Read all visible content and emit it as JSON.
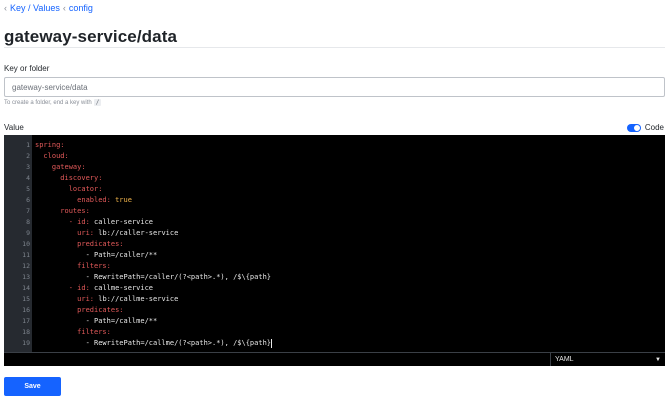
{
  "breadcrumb": {
    "items": [
      "Key / Values",
      "config"
    ]
  },
  "page": {
    "title": "gateway-service/data"
  },
  "key_field": {
    "label": "Key or folder",
    "value": "gateway-service/data",
    "hint_prefix": "To create a folder, end a key with",
    "hint_code": "/"
  },
  "value_field": {
    "label": "Value",
    "code_toggle_label": "Code",
    "code_toggle_on": true
  },
  "editor": {
    "lines": [
      {
        "n": "1",
        "segs": [
          [
            "",
            "spring"
          ],
          [
            "k",
            ":"
          ]
        ]
      },
      {
        "n": "2",
        "segs": [
          [
            "",
            "  cloud"
          ],
          [
            "k",
            ":"
          ]
        ]
      },
      {
        "n": "3",
        "segs": [
          [
            "",
            "    gateway"
          ],
          [
            "k",
            ":"
          ]
        ]
      },
      {
        "n": "4",
        "segs": [
          [
            "",
            "      discovery"
          ],
          [
            "k",
            ":"
          ]
        ]
      },
      {
        "n": "5",
        "segs": [
          [
            "",
            "        locator"
          ],
          [
            "k",
            ":"
          ]
        ]
      },
      {
        "n": "6",
        "segs": [
          [
            "",
            "          enabled"
          ],
          [
            "k",
            ": "
          ],
          [
            "b",
            "true"
          ]
        ]
      },
      {
        "n": "7",
        "segs": [
          [
            "",
            "      routes"
          ],
          [
            "k",
            ":"
          ]
        ]
      },
      {
        "n": "8",
        "segs": [
          [
            "k",
            "        - id"
          ],
          [
            "k",
            ": "
          ],
          [
            "v",
            "caller-service"
          ]
        ]
      },
      {
        "n": "9",
        "segs": [
          [
            "k",
            "          uri"
          ],
          [
            "k",
            ": "
          ],
          [
            "v",
            "lb://caller-service"
          ]
        ]
      },
      {
        "n": "10",
        "segs": [
          [
            "k",
            "          predicates"
          ],
          [
            "k",
            ":"
          ]
        ]
      },
      {
        "n": "11",
        "segs": [
          [
            "v",
            "            - Path=/caller/**"
          ]
        ]
      },
      {
        "n": "12",
        "segs": [
          [
            "k",
            "          filters"
          ],
          [
            "k",
            ":"
          ]
        ]
      },
      {
        "n": "13",
        "segs": [
          [
            "v",
            "            - RewritePath=/caller/(?<path>.*), /$\\{path}"
          ]
        ]
      },
      {
        "n": "14",
        "segs": [
          [
            "k",
            "        - id"
          ],
          [
            "k",
            ": "
          ],
          [
            "v",
            "callme-service"
          ]
        ]
      },
      {
        "n": "15",
        "segs": [
          [
            "k",
            "          uri"
          ],
          [
            "k",
            ": "
          ],
          [
            "v",
            "lb://callme-service"
          ]
        ]
      },
      {
        "n": "16",
        "segs": [
          [
            "k",
            "          predicates"
          ],
          [
            "k",
            ":"
          ]
        ]
      },
      {
        "n": "17",
        "segs": [
          [
            "v",
            "            - Path=/callme/**"
          ]
        ]
      },
      {
        "n": "18",
        "segs": [
          [
            "k",
            "          filters"
          ],
          [
            "k",
            ":"
          ]
        ]
      },
      {
        "n": "19",
        "segs": [
          [
            "v",
            "            - RewritePath=/callme/(?<path>.*), /$\\{path}"
          ]
        ]
      }
    ],
    "mode": "YAML"
  },
  "actions": {
    "save_label": "Save"
  },
  "colors": {
    "accent": "#1563ff",
    "editor_bg": "#000000",
    "gutter_bg": "#262a30",
    "yaml_key": "#e35a5a",
    "yaml_value": "#e8e8e8",
    "yaml_bool": "#f2b54b"
  },
  "icons": {
    "breadcrumb_chevron": "chevron-left-icon",
    "mode_caret": "caret-down-icon"
  }
}
